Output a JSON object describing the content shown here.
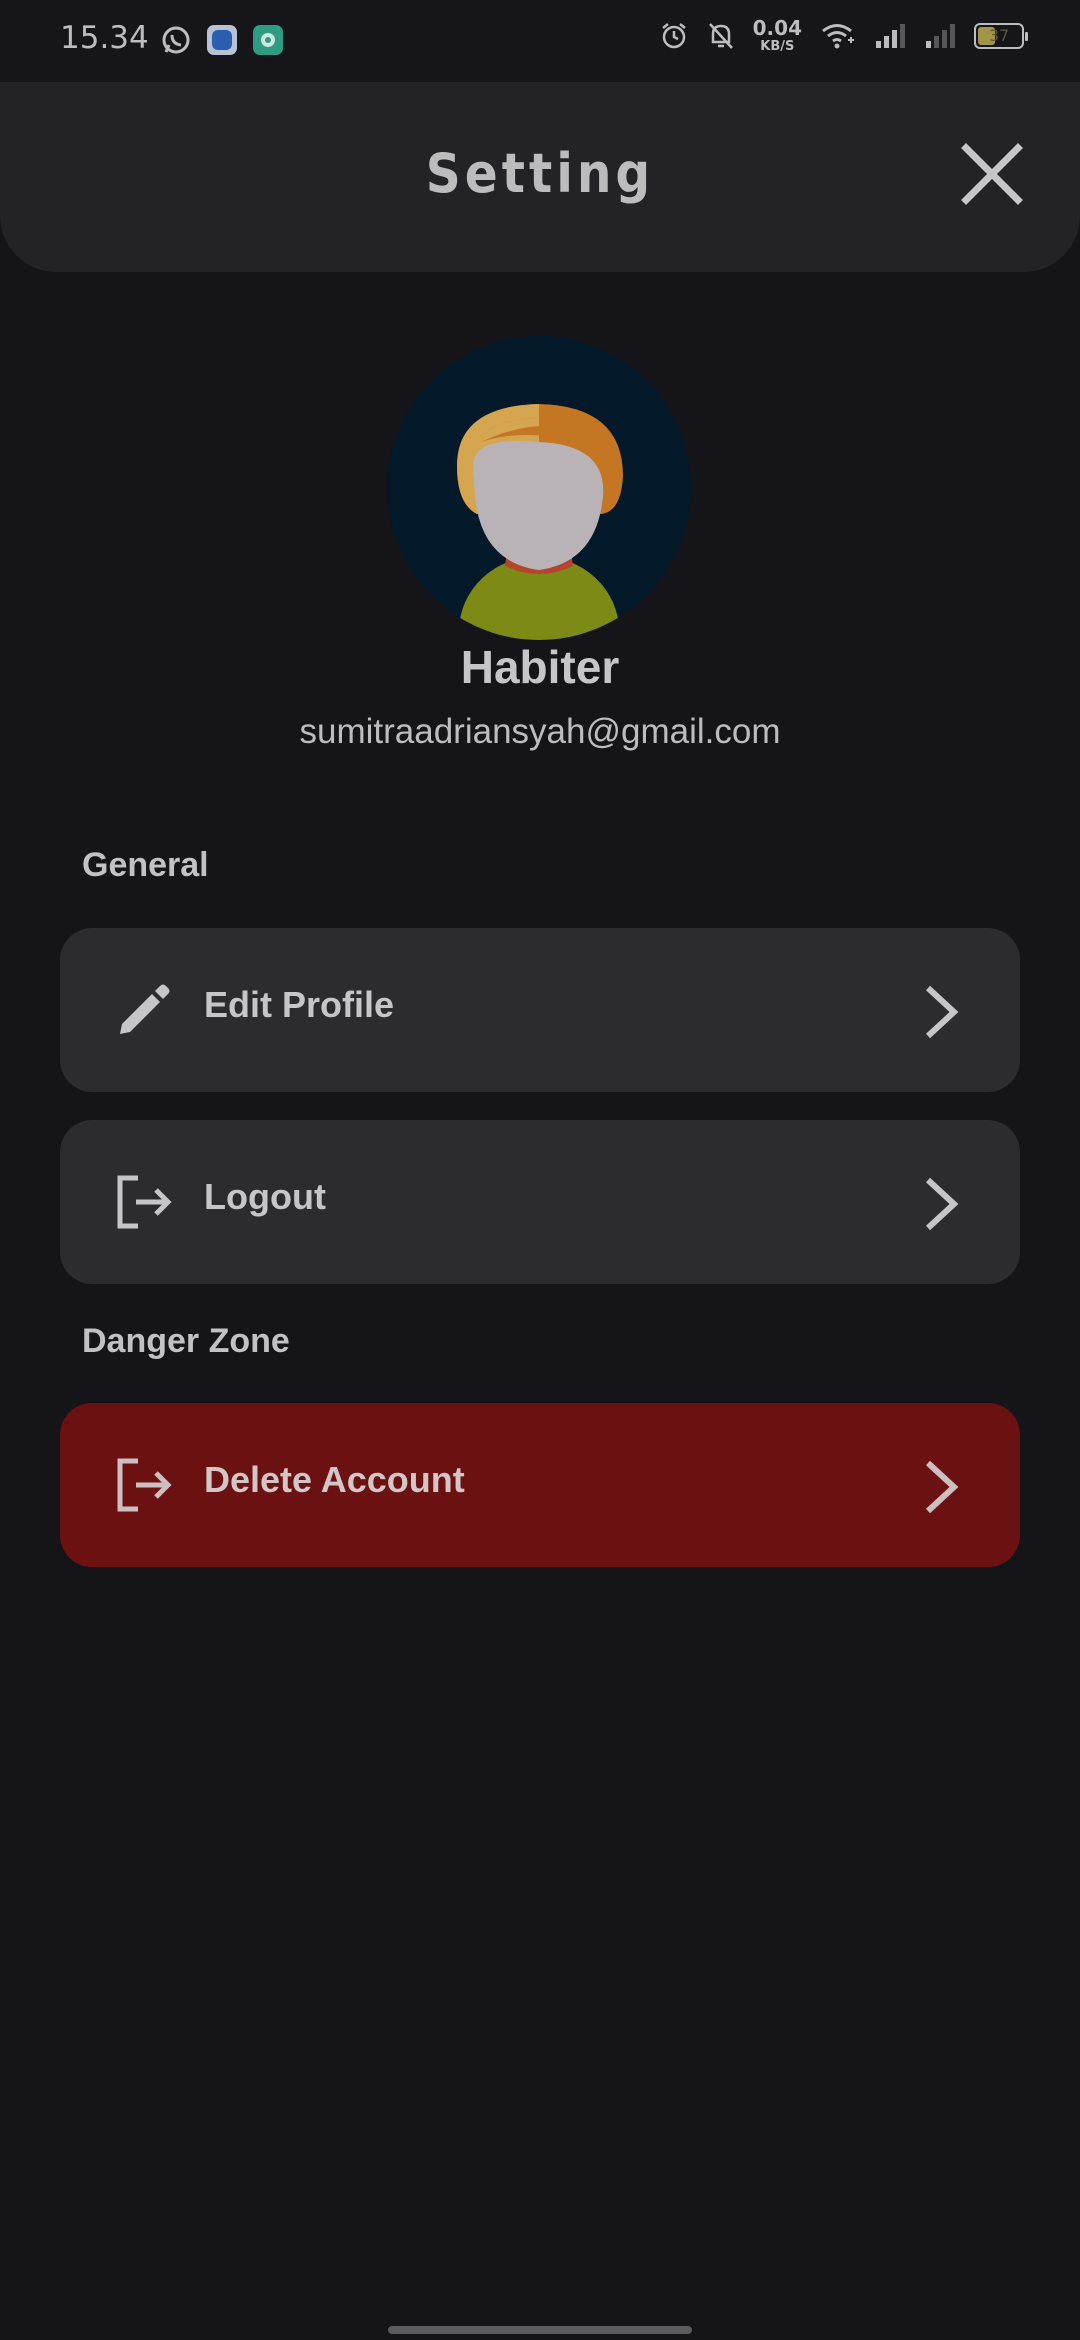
{
  "status_bar": {
    "time": "15.34",
    "net_speed_value": "0.04",
    "net_speed_unit": "KB/S",
    "battery_level": "37"
  },
  "header": {
    "title": "Setting"
  },
  "profile": {
    "name": "Habiter",
    "email": "sumitraadriansyah@gmail.com"
  },
  "sections": {
    "general_label": "General",
    "danger_label": "Danger Zone"
  },
  "items": {
    "edit_profile": "Edit Profile",
    "logout": "Logout",
    "delete_account": "Delete Account"
  },
  "icons": {
    "close": "close-icon",
    "edit": "pencil-icon",
    "logout": "logout-icon",
    "delete": "logout-icon",
    "chevron": "chevron-right-icon"
  },
  "colors": {
    "background": "#141419",
    "header": "#222227",
    "card": "#2c2c2e",
    "danger": "#6c1112",
    "text": "#c6c6c8"
  }
}
